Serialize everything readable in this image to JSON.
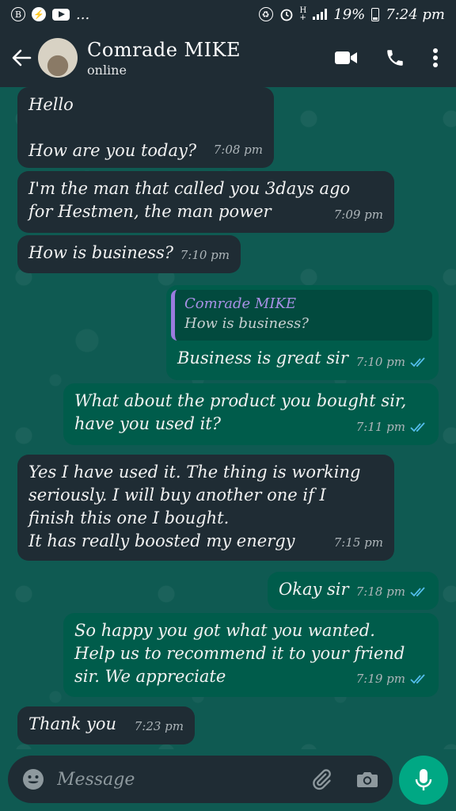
{
  "status_bar": {
    "left_icons": [
      "b-icon",
      "bolt-icon",
      "youtube-icon",
      "more-dots"
    ],
    "more_text": "...",
    "battery": "19%",
    "time": "7:24 pm"
  },
  "header": {
    "contact_name": "Comrade MIKE",
    "status": "online"
  },
  "messages": [
    {
      "dir": "in",
      "lines": [
        "Hello",
        "",
        "How are you today?"
      ],
      "time": "7:08 pm"
    },
    {
      "dir": "in",
      "lines": [
        "I'm the man that called you 3days ago",
        "for Hestmen, the man power"
      ],
      "time": "7:09 pm"
    },
    {
      "dir": "in",
      "lines": [
        "How is business?"
      ],
      "time": "7:10 pm"
    },
    {
      "dir": "out",
      "quote": {
        "name": "Comrade MIKE",
        "text": "How is business?"
      },
      "lines": [
        "Business is great sir"
      ],
      "time": "7:10 pm",
      "read": true
    },
    {
      "dir": "out",
      "lines": [
        "What about the product you bought sir,",
        "have you used it?"
      ],
      "time": "7:11 pm",
      "read": true
    },
    {
      "dir": "in",
      "lines": [
        "Yes I have used it. The thing is working",
        "seriously. I will buy another one if I",
        "finish this one I bought.",
        "It has really boosted my energy"
      ],
      "time": "7:15 pm"
    },
    {
      "dir": "out",
      "lines": [
        "Okay sir"
      ],
      "time": "7:18 pm",
      "read": true
    },
    {
      "dir": "out",
      "lines": [
        "So happy you got what you wanted.",
        "Help us to recommend it to your friend",
        "sir. We appreciate"
      ],
      "time": "7:19 pm",
      "read": true
    },
    {
      "dir": "in",
      "lines": [
        "Thank you"
      ],
      "time": "7:23 pm"
    }
  ],
  "composer": {
    "placeholder": "Message"
  },
  "colors": {
    "bar": "#1f2c34",
    "incoming": "#1f2c34",
    "outgoing": "#005c4b",
    "wallpaper": "#0f5a52",
    "accent": "#00a884",
    "read_ticks": "#53bdeb",
    "quote_name": "#a891e6"
  }
}
